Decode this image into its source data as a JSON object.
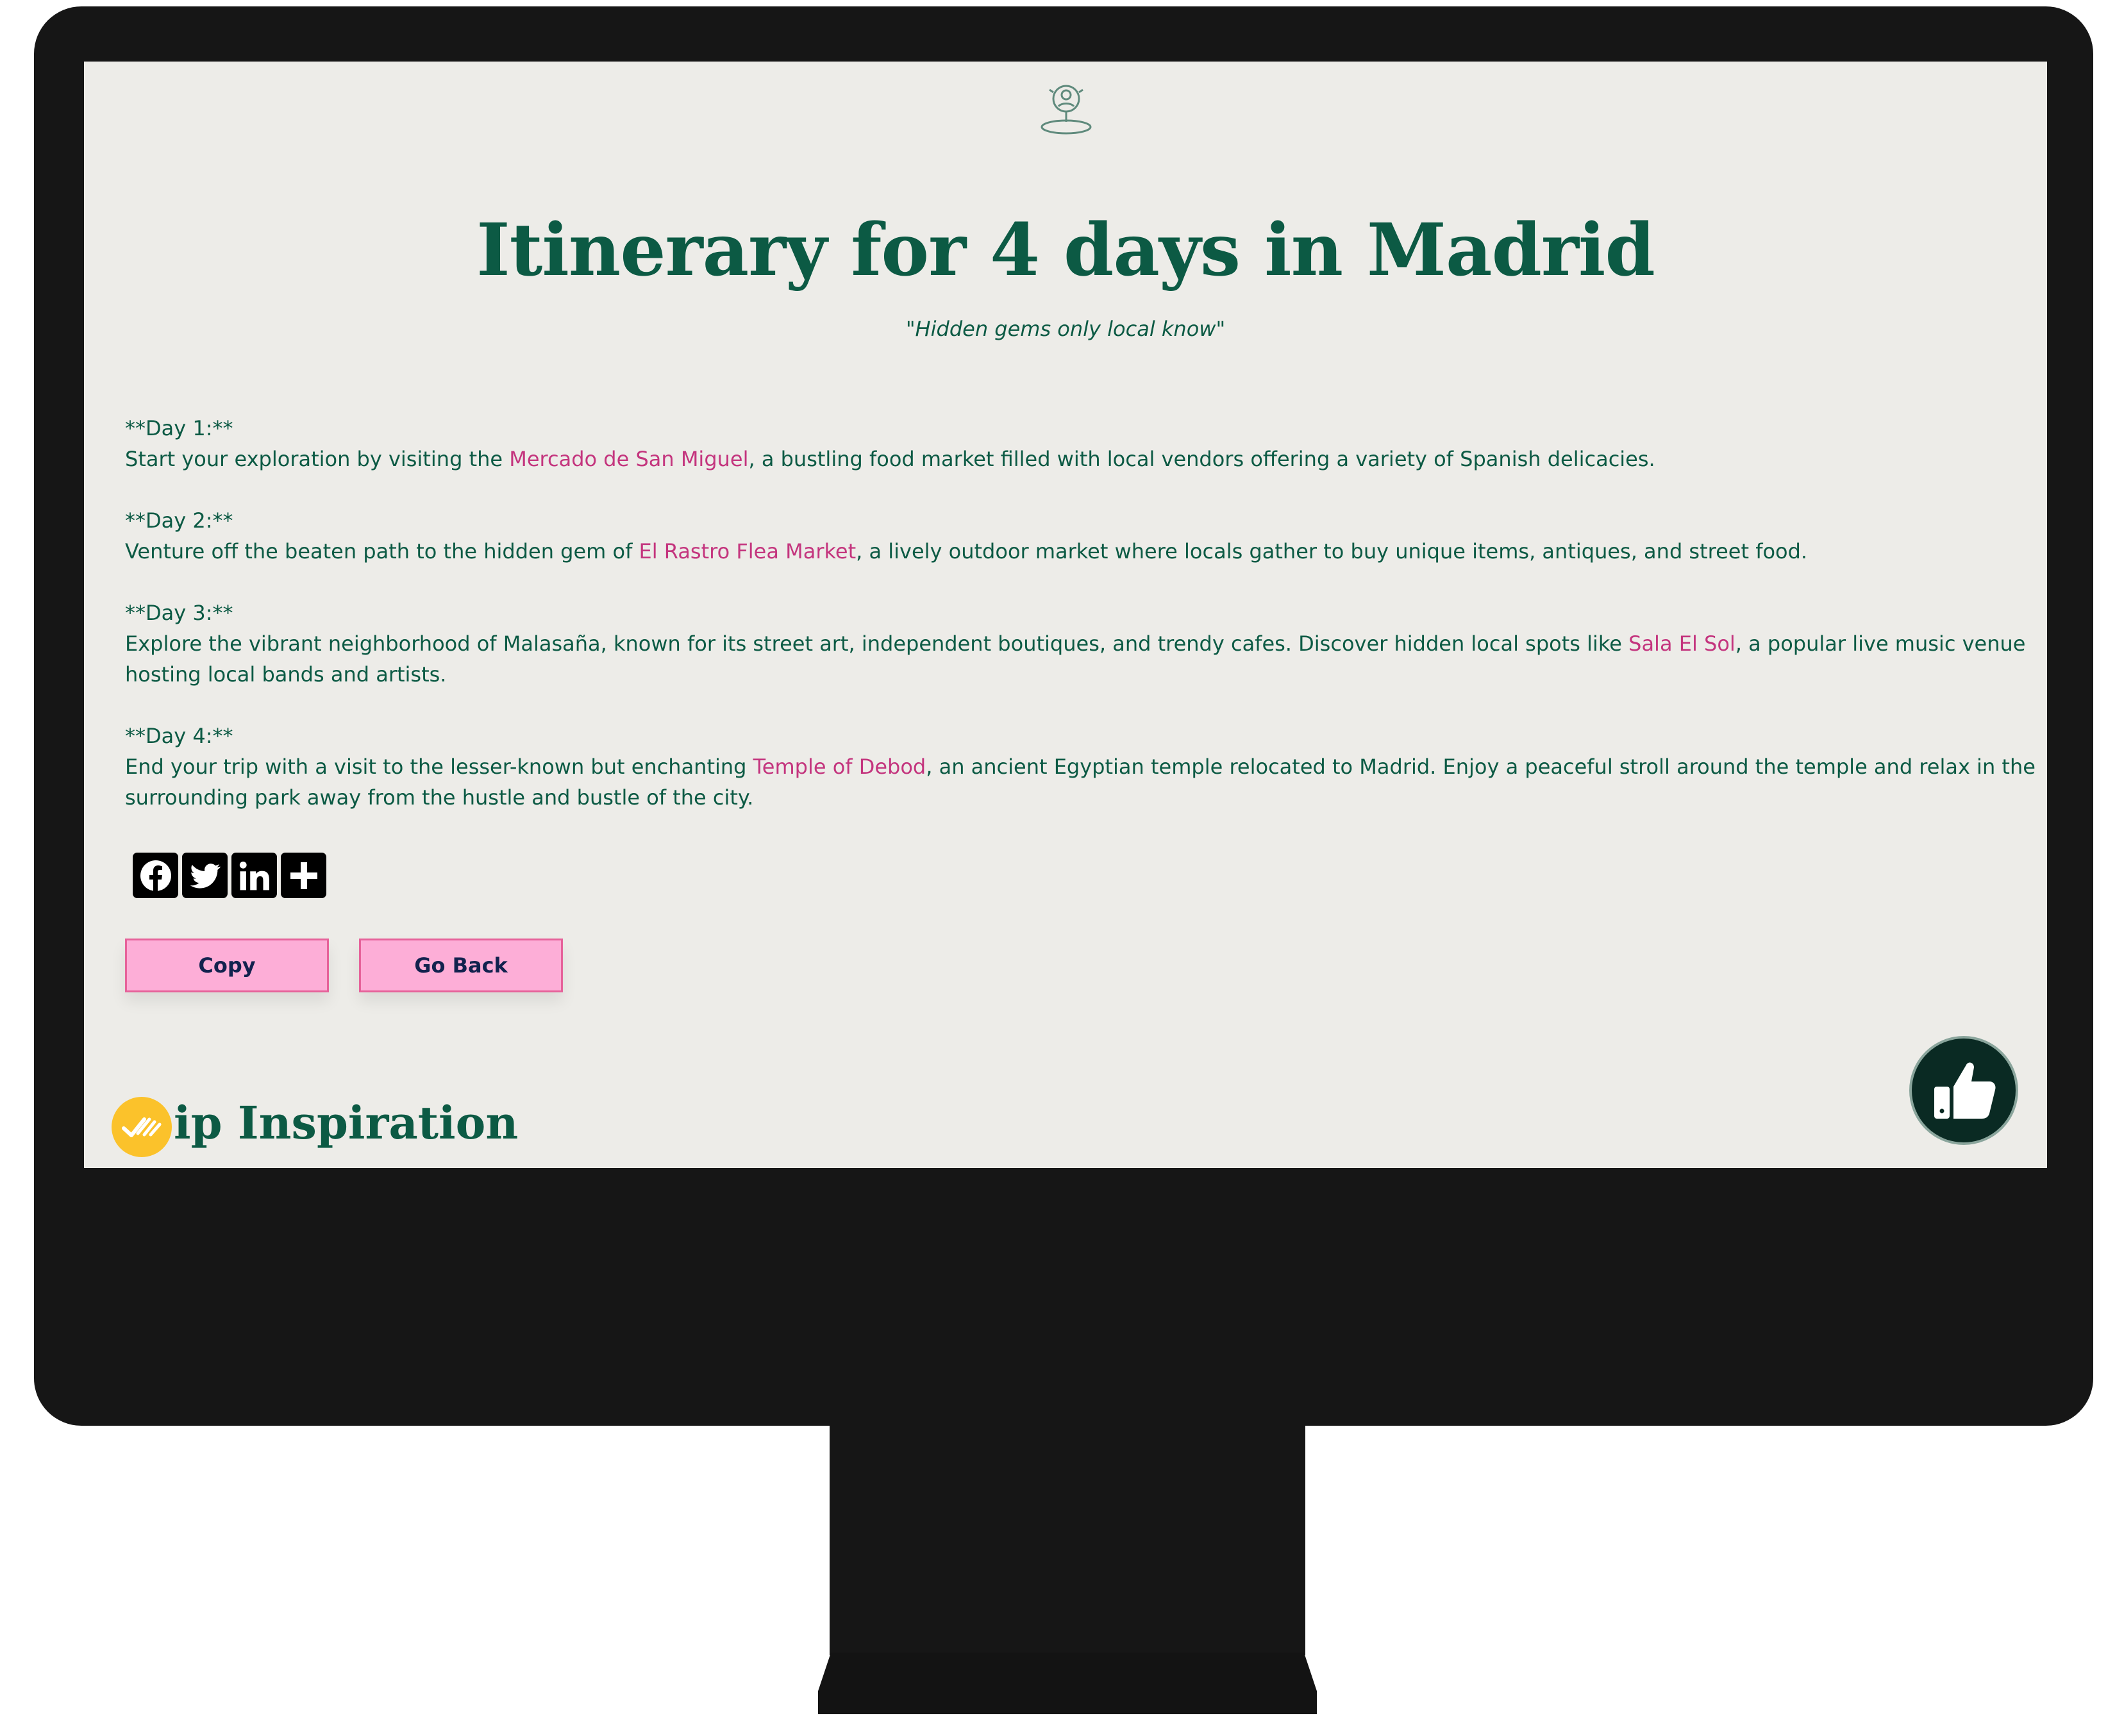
{
  "page": {
    "title": "Itinerary for 4 days in Madrid",
    "subtitle": "\"Hidden gems only local know\""
  },
  "days": [
    {
      "heading": "**Day 1:**",
      "text_before": "Start your exploration by visiting the ",
      "place": "Mercado de San Miguel",
      "text_after": ", a bustling food market filled with local vendors offering a variety of Spanish delicacies."
    },
    {
      "heading": "**Day 2:**",
      "text_before": "Venture off the beaten path to the hidden gem of ",
      "place": "El Rastro Flea Market",
      "text_after": ", a lively outdoor market where locals gather to buy unique items, antiques, and street food."
    },
    {
      "heading": "**Day 3:**",
      "text_before": "Explore the vibrant neighborhood of Malasaña, known for its street art, independent boutiques, and trendy cafes. Discover hidden local spots like ",
      "place": "Sala El Sol",
      "text_after": ", a popular live music venue hosting local bands and artists."
    },
    {
      "heading": "**Day 4:**",
      "text_before": "End your trip with a visit to the lesser-known but enchanting ",
      "place": "Temple of Debod",
      "text_after": ", an ancient Egyptian temple relocated to Madrid. Enjoy a peaceful stroll around the temple and relax in the surrounding park away from the hustle and bustle of the city."
    }
  ],
  "share": {
    "buttons": [
      {
        "icon": "facebook-icon"
      },
      {
        "icon": "twitter-icon"
      },
      {
        "icon": "linkedin-icon"
      },
      {
        "icon": "plus-icon"
      }
    ]
  },
  "actions": {
    "copy_label": "Copy",
    "back_label": "Go Back"
  },
  "footer": {
    "brand_visible": "ip Inspiration",
    "badge_icon": "checkmark-badge-icon",
    "feedback_icon": "thumbs-up-icon"
  },
  "colors": {
    "primary_green": "#0c5a44",
    "link_pink": "#c4357e",
    "button_pink": "#fdaed7",
    "button_border": "#e6629a",
    "screen_bg": "#edece8",
    "bezel": "#161616",
    "badge_yellow": "#fbc22b"
  }
}
